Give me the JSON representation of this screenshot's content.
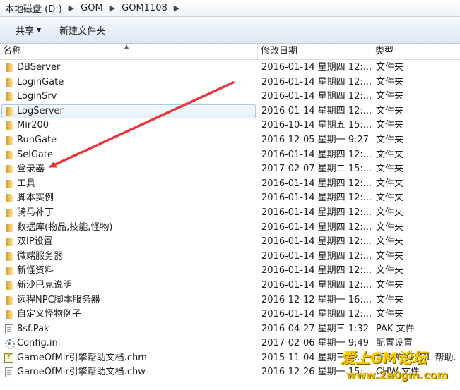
{
  "breadcrumb": [
    "本地磁盘 (D:)",
    "GOM",
    "GOM1108"
  ],
  "toolbar": {
    "share_label": "共享",
    "new_folder_label": "新建文件夹"
  },
  "columns": {
    "name": "名称",
    "date": "修改日期",
    "type": "类型"
  },
  "rows": [
    {
      "name": "DBServer",
      "date": "2016-01-14 星期四 12:...",
      "type": "文件夹",
      "icon": "folder"
    },
    {
      "name": "LoginGate",
      "date": "2016-01-14 星期四 12:...",
      "type": "文件夹",
      "icon": "folder"
    },
    {
      "name": "LoginSrv",
      "date": "2016-01-14 星期四 12:...",
      "type": "文件夹",
      "icon": "folder"
    },
    {
      "name": "LogServer",
      "date": "2016-01-14 星期四 12:...",
      "type": "文件夹",
      "icon": "folder",
      "selected": true
    },
    {
      "name": "Mir200",
      "date": "2016-10-14 星期五 15:...",
      "type": "文件夹",
      "icon": "folder"
    },
    {
      "name": "RunGate",
      "date": "2016-12-05 星期一 9:27",
      "type": "文件夹",
      "icon": "folder"
    },
    {
      "name": "SelGate",
      "date": "2016-01-14 星期四 12:...",
      "type": "文件夹",
      "icon": "folder"
    },
    {
      "name": "登录器",
      "date": "2017-02-07 星期二 15:...",
      "type": "文件夹",
      "icon": "folder"
    },
    {
      "name": "工具",
      "date": "2016-01-14 星期四 12:...",
      "type": "文件夹",
      "icon": "folder"
    },
    {
      "name": "脚本实例",
      "date": "2016-01-14 星期四 12:...",
      "type": "文件夹",
      "icon": "folder"
    },
    {
      "name": "骑马补丁",
      "date": "2016-01-14 星期四 12:...",
      "type": "文件夹",
      "icon": "folder"
    },
    {
      "name": "数据库(物品,技能,怪物)",
      "date": "2016-01-14 星期四 12:...",
      "type": "文件夹",
      "icon": "folder"
    },
    {
      "name": "双IP设置",
      "date": "2016-01-14 星期四 12:...",
      "type": "文件夹",
      "icon": "folder"
    },
    {
      "name": "微端服务器",
      "date": "2016-01-14 星期四 12:...",
      "type": "文件夹",
      "icon": "folder"
    },
    {
      "name": "新怪资料",
      "date": "2016-01-14 星期四 12:...",
      "type": "文件夹",
      "icon": "folder"
    },
    {
      "name": "新沙巴克说明",
      "date": "2016-01-14 星期四 12:...",
      "type": "文件夹",
      "icon": "folder"
    },
    {
      "name": "远程NPC脚本服务器",
      "date": "2016-12-12 星期一 16:...",
      "type": "文件夹",
      "icon": "folder"
    },
    {
      "name": "自定义怪物例子",
      "date": "2016-01-14 星期四 12:...",
      "type": "文件夹",
      "icon": "folder"
    },
    {
      "name": "8sf.Pak",
      "date": "2016-04-27 星期三 1:32",
      "type": "PAK 文件",
      "icon": "file"
    },
    {
      "name": "Config.ini",
      "date": "2017-02-06 星期一 9:49",
      "type": "配置设置",
      "icon": "gear"
    },
    {
      "name": "GameOfMir引擎帮助文档.chm",
      "date": "2015-11-04 星期三 1...",
      "type": "编译的 HTML 帮助...",
      "icon": "help"
    },
    {
      "name": "GameOfMir引擎帮助文档.chw",
      "date": "2016-12-26 星期一 15:...",
      "type": "CHW 文件",
      "icon": "file"
    }
  ],
  "watermark": {
    "title": "爱上GM论坛",
    "url": "www.2a0gm.com"
  },
  "colors": {
    "annotation_arrow": "#e8383c",
    "selection_border": "#aac9ea",
    "folder": "#f2cf6b"
  }
}
